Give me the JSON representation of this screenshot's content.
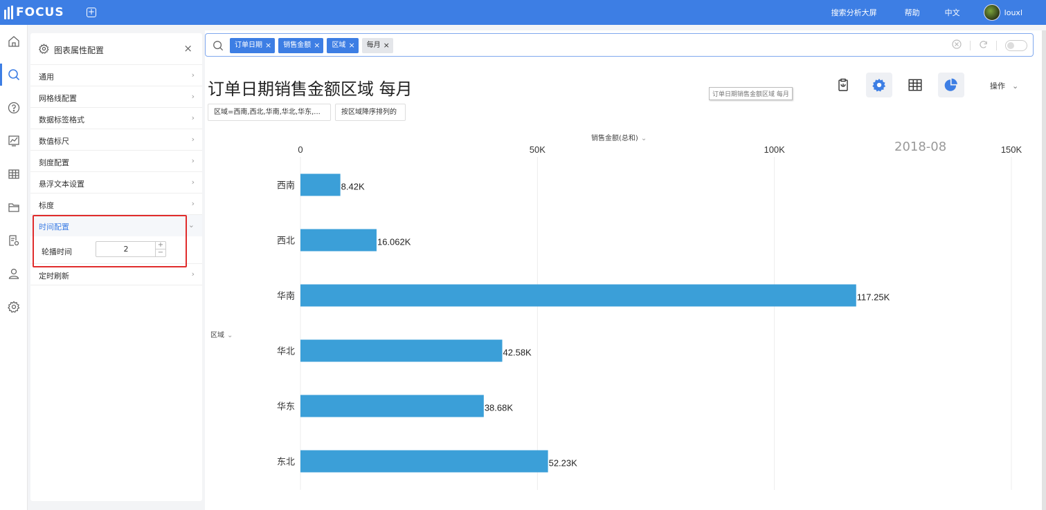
{
  "app": {
    "logo": "FOCUS"
  },
  "topbar": {
    "links": [
      "搜索分析大屏",
      "帮助",
      "中文"
    ],
    "user": "louxl"
  },
  "rail": {
    "icons": [
      "home-icon",
      "search-icon",
      "help-icon",
      "chart-icon",
      "table-icon",
      "folder-icon",
      "report-settings-icon",
      "user-icon",
      "settings-icon"
    ],
    "active_index": 1
  },
  "panel": {
    "title": "图表属性配置",
    "close": "×",
    "items": [
      "通用",
      "网格线配置",
      "数据标签格式",
      "数值标尺",
      "刻度配置",
      "悬浮文本设置",
      "标度",
      "时间配置",
      "定时刷新"
    ],
    "open_index": 7,
    "sub_label": "轮播时间",
    "sub_value": "2"
  },
  "search": {
    "chips": [
      {
        "label": "订单日期",
        "style": "blue",
        "close": "×"
      },
      {
        "label": "销售金额",
        "style": "blue",
        "close": "×"
      },
      {
        "label": "区域",
        "style": "blue",
        "close": "×"
      },
      {
        "label": "每月",
        "style": "gray",
        "close": "×"
      }
    ]
  },
  "chart_header": {
    "title": "订单日期销售金额区域 每月",
    "tooltip": "订单日期销售金额区域 每月",
    "operate": "操作",
    "filter_tag": "区域=西南,西北,华南,华北,华东,...",
    "sort_tag": "按区域降序排列的"
  },
  "chart_data": {
    "type": "bar",
    "orientation": "horizontal",
    "xlabel": "销售金额(总和)",
    "ylabel": "区域",
    "watermark": "2018-08",
    "xlim": [
      0,
      150000
    ],
    "xticks": [
      0,
      50000,
      100000,
      150000
    ],
    "xtick_labels": [
      "0",
      "50K",
      "100K",
      "150K"
    ],
    "categories": [
      "西南",
      "西北",
      "华南",
      "华北",
      "华东",
      "东北"
    ],
    "values": [
      8420,
      16062,
      117250,
      42580,
      38680,
      52230
    ],
    "data_labels": [
      "8.42K",
      "16.062K",
      "117.25K",
      "42.58K",
      "38.68K",
      "52.23K"
    ],
    "bar_color": "#3b9fd8",
    "grid": true
  },
  "colors": {
    "accent": "#3d7ee4",
    "highlight": "#e02b2b"
  }
}
